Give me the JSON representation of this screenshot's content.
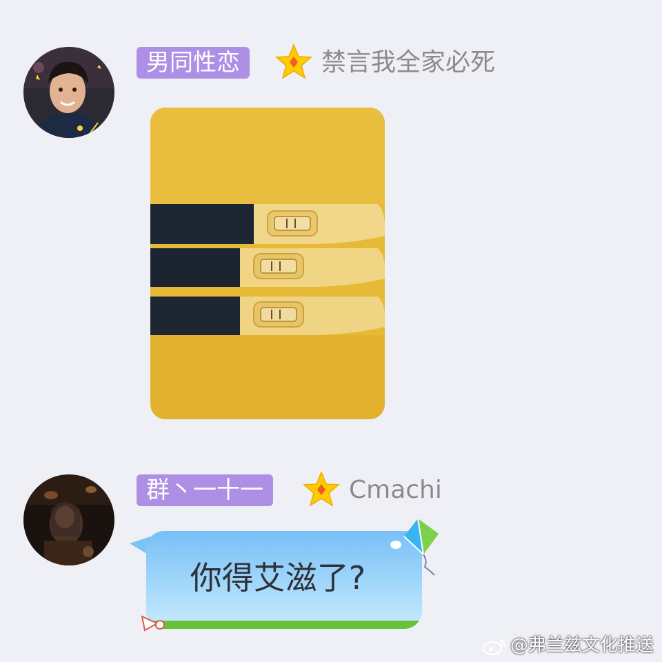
{
  "messages": [
    {
      "avatar": "portrait-avatar",
      "title_badge": "男同性恋",
      "badge_color": "#ad8fe6",
      "level_icon": "star-icon",
      "nickname": "禁言我全家必死",
      "content_type": "image",
      "image": "pregnancy-tests-photo"
    },
    {
      "avatar": "dark-scene-avatar",
      "title_badge": "群丶一十一",
      "badge_color": "#ad8fe6",
      "level_icon": "star-icon",
      "nickname": "Cmachi",
      "content_type": "text",
      "text": "你得艾滋了?",
      "bubble_decoration": "kite-icon"
    }
  ],
  "watermark": {
    "icon": "weibo-icon",
    "text": "@弗兰兹文化推送"
  },
  "colors": {
    "background": "#eef0f6",
    "badge": "#ad8fe6",
    "bubble_top": "#77c0f6",
    "grass": "#66c23a",
    "star": "#ffcc00"
  }
}
